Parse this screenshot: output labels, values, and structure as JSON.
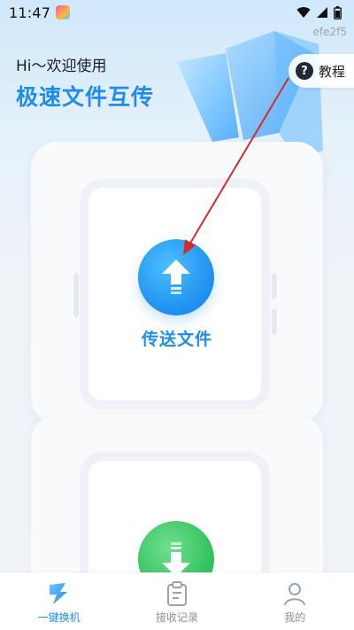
{
  "status_bar": {
    "time": "11:47",
    "app_icon": "colorful-app-icon",
    "icons": [
      "wifi-icon",
      "signal-icon",
      "battery-icon"
    ]
  },
  "build_id": "efe2f5",
  "hero": {
    "greeting": "Hi～欢迎使用",
    "headline": "极速文件互传"
  },
  "tutorial": {
    "label": "教程",
    "icon": "question-mark-icon"
  },
  "send_card": {
    "label": "传送文件",
    "icon": "upload-arrow-icon"
  },
  "receive_card": {
    "icon": "download-arrow-icon"
  },
  "bottom_nav": {
    "items": [
      {
        "label": "一键换机",
        "icon": "switch-phone-icon",
        "active": true
      },
      {
        "label": "接收记录",
        "icon": "clipboard-icon",
        "active": false
      },
      {
        "label": "我的",
        "icon": "person-icon",
        "active": false
      }
    ]
  },
  "colors": {
    "accent": "#1f8cf0",
    "send": "#1d8ff0",
    "receive": "#2fbf5c",
    "annotation_arrow": "#d62b2b"
  }
}
